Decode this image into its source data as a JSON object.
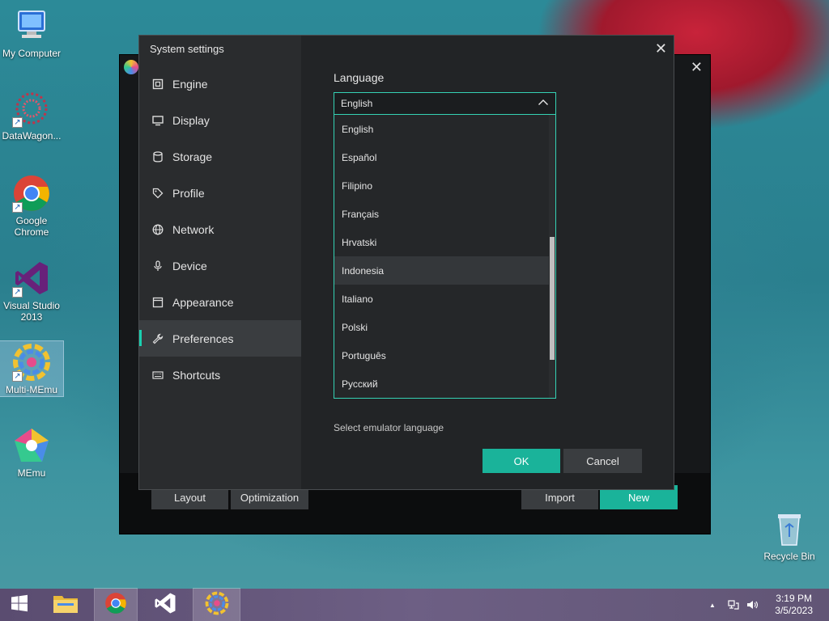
{
  "desktop": {
    "icons": [
      {
        "label": "My Computer"
      },
      {
        "label": "DataWagon..."
      },
      {
        "label": "Google Chrome"
      },
      {
        "label": "Visual Studio 2013"
      },
      {
        "label": "Multi-MEmu"
      },
      {
        "label": "MEmu"
      },
      {
        "label": "Recycle Bin"
      }
    ]
  },
  "main_window": {
    "close_glyph": "✕",
    "footer": {
      "layout_label": "Layout",
      "optimization_label": "Optimization",
      "import_label": "Import",
      "new_label": "New"
    }
  },
  "dialog": {
    "title": "System settings",
    "close_glyph": "✕",
    "nav": [
      {
        "label": "Engine",
        "icon": "chip-icon"
      },
      {
        "label": "Display",
        "icon": "monitor-icon"
      },
      {
        "label": "Storage",
        "icon": "database-icon"
      },
      {
        "label": "Profile",
        "icon": "tag-icon"
      },
      {
        "label": "Network",
        "icon": "globe-icon"
      },
      {
        "label": "Device",
        "icon": "microphone-icon"
      },
      {
        "label": "Appearance",
        "icon": "window-icon"
      },
      {
        "label": "Preferences",
        "icon": "wrench-icon",
        "active": true
      },
      {
        "label": "Shortcuts",
        "icon": "keyboard-icon"
      }
    ],
    "language": {
      "label": "Language",
      "selected": "English",
      "options": [
        "English",
        "Español",
        "Filipino",
        "Français",
        "Hrvatski",
        "Indonesia",
        "Italiano",
        "Polski",
        "Português",
        "Русский"
      ],
      "hovered": "Indonesia",
      "hint": "Select emulator language"
    },
    "ok_label": "OK",
    "cancel_label": "Cancel"
  },
  "taskbar": {
    "time": "3:19 PM",
    "date": "3/5/2023",
    "tray_up": "▲"
  },
  "colors": {
    "accent": "#1ab39a",
    "dialog_bg": "#222426",
    "sidebar_bg": "#2a2c2e"
  }
}
